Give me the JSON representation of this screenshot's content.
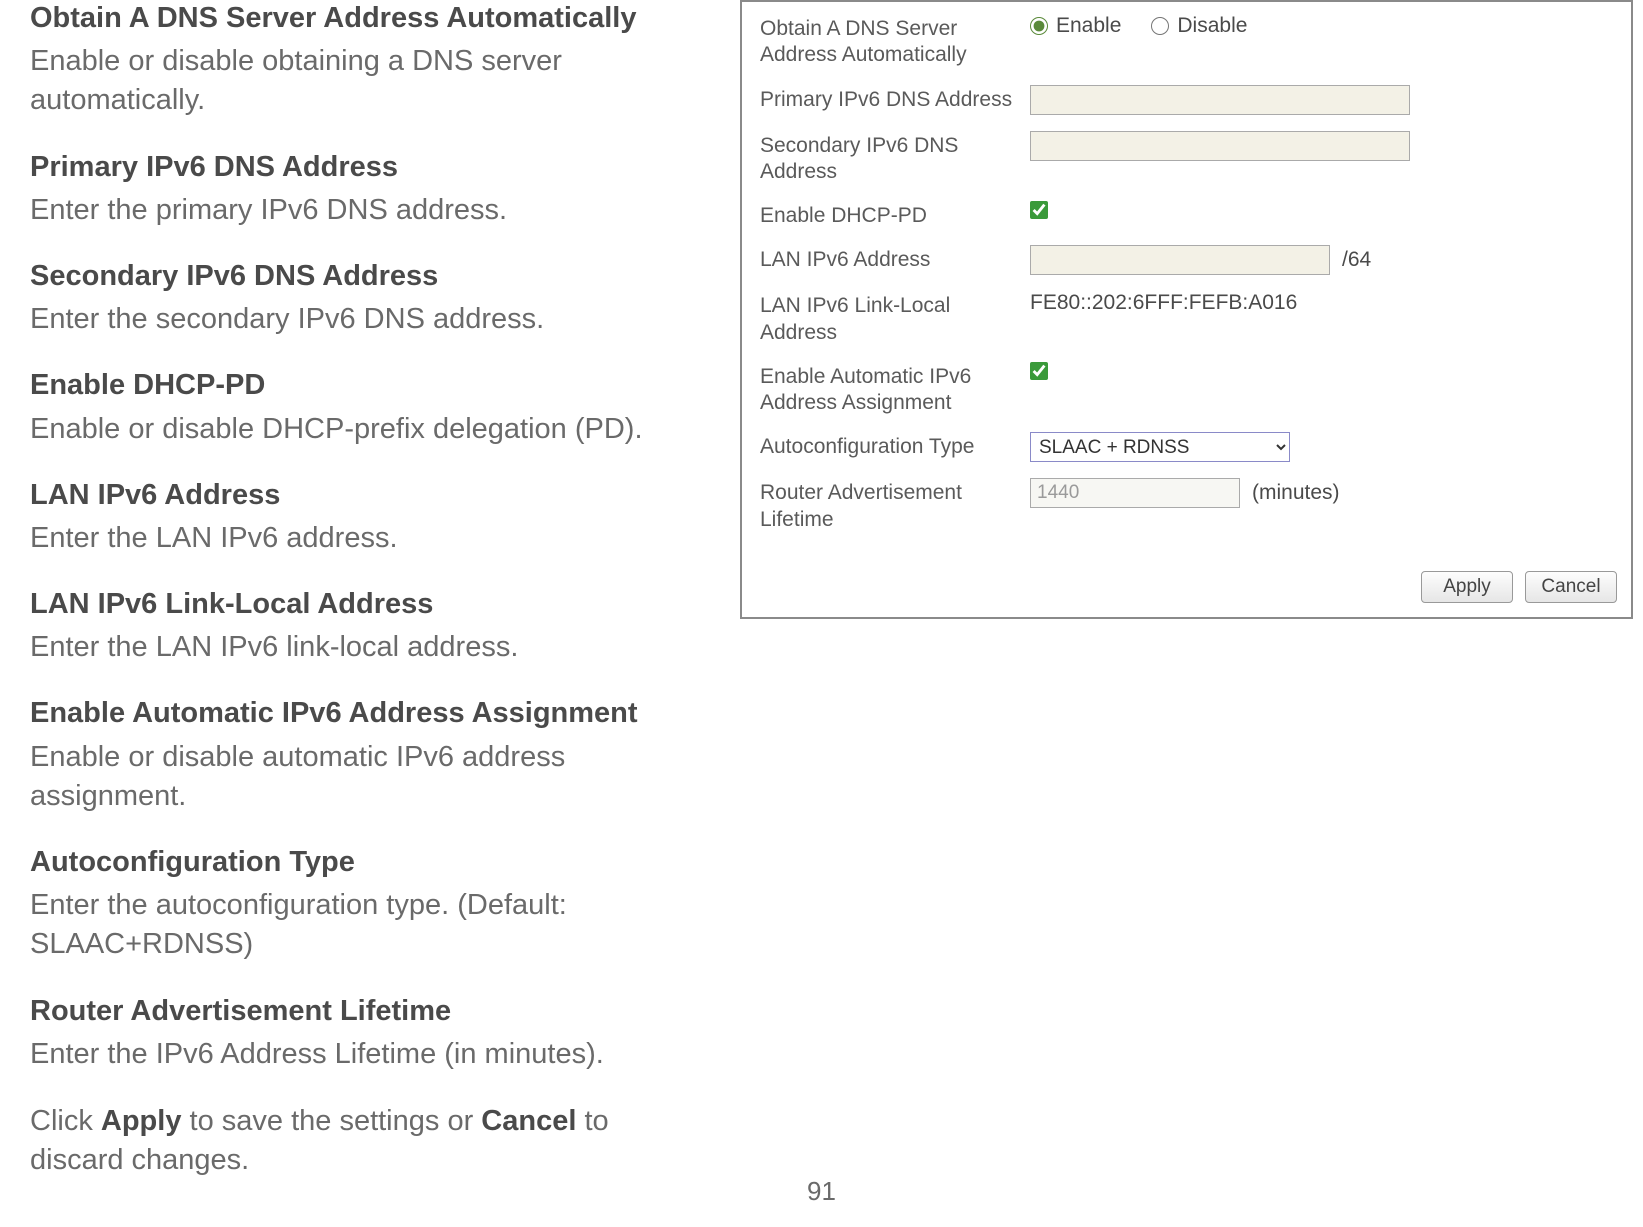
{
  "doc": {
    "sections": [
      {
        "title": "Obtain A DNS Server Address Automatically",
        "desc": "Enable or disable obtaining a DNS server automatically."
      },
      {
        "title": "Primary IPv6 DNS Address",
        "desc": "Enter the primary IPv6 DNS address."
      },
      {
        "title": "Secondary IPv6 DNS Address",
        "desc": "Enter the secondary IPv6 DNS address."
      },
      {
        "title": "Enable DHCP-PD",
        "desc": "Enable or disable DHCP-prefix delegation (PD)."
      },
      {
        "title": "LAN IPv6 Address",
        "desc": "Enter the LAN IPv6 address."
      },
      {
        "title": "LAN IPv6 Link-Local Address",
        "desc": "Enter the LAN IPv6 link-local address."
      },
      {
        "title": "Enable Automatic IPv6 Address Assignment",
        "desc": "Enable or disable automatic IPv6 address assignment."
      },
      {
        "title": "Autoconfiguration Type",
        "desc": "Enter the autoconfiguration type. (Default: SLAAC+RDNSS)"
      },
      {
        "title": "Router Advertisement Lifetime",
        "desc": "Enter the IPv6 Address Lifetime (in minutes)."
      }
    ],
    "final_prefix": "Click ",
    "final_apply": "Apply",
    "final_mid": " to save the settings or ",
    "final_cancel": "Cancel",
    "final_suffix": " to discard changes.",
    "page_number": "91"
  },
  "panel": {
    "rows": {
      "dns_auto": {
        "label": "Obtain A DNS Server Address Automatically",
        "enable": "Enable",
        "disable": "Disable",
        "selected": "enable"
      },
      "primary_dns": {
        "label": "Primary IPv6 DNS Address",
        "value": ""
      },
      "secondary_dns": {
        "label": "Secondary IPv6 DNS Address",
        "value": ""
      },
      "dhcp_pd": {
        "label": "Enable DHCP-PD",
        "checked": true
      },
      "lan_ipv6": {
        "label": "LAN IPv6 Address",
        "value": "",
        "suffix": "/64"
      },
      "link_local": {
        "label": "LAN IPv6 Link-Local Address",
        "value": "FE80::202:6FFF:FEFB:A016"
      },
      "auto_assign": {
        "label": "Enable Automatic IPv6 Address Assignment",
        "checked": true
      },
      "autoconf": {
        "label": "Autoconfiguration Type",
        "value": "SLAAC + RDNSS"
      },
      "ra_lifetime": {
        "label": "Router Advertisement Lifetime",
        "value": "1440",
        "unit": "(minutes)"
      }
    },
    "buttons": {
      "apply": "Apply",
      "cancel": "Cancel"
    }
  }
}
